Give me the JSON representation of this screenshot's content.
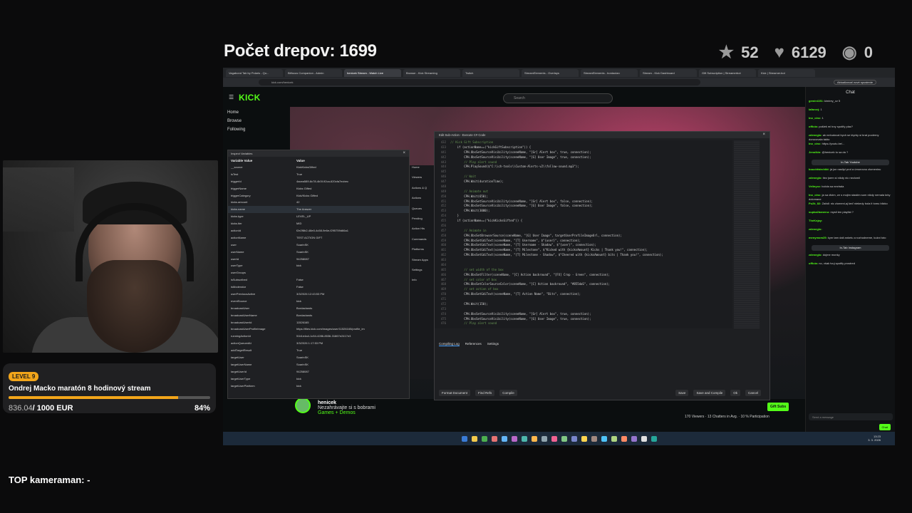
{
  "overlay": {
    "title": "Počet drepov: 1699",
    "stats": [
      {
        "icon": "star-icon",
        "glyph": "★",
        "value": "52"
      },
      {
        "icon": "heart-icon",
        "glyph": "♥",
        "value": "6129"
      },
      {
        "icon": "eye-icon",
        "glyph": "◉",
        "value": "0"
      }
    ],
    "goal": {
      "level": "LEVEL 9",
      "title": "Ondrej Macko maratón 8 hodinový stream",
      "current": "836.04",
      "total": "/ 1000 EUR",
      "percent_label": "84%",
      "progress": 0.84
    },
    "kameraman": "TOP kameraman: -"
  },
  "browser": {
    "tabs": [
      "Vagabond Tab by Polaris - Qu...",
      "Bitfocus Companion - Admin",
      "henicek Stream - Watch Live",
      "Browse - Kick Streaming",
      "Twitch",
      "StreamElements - Overlays",
      "StreamElements - bordaclan",
      "Stream - Kick Dashboard",
      "Gift Subscription | Streamerbot",
      "Kick | Streamer.bot"
    ],
    "active_tab": 2,
    "url": "kick.com/henicek",
    "update_label": "Aktualizovať nové spustenie"
  },
  "kick": {
    "logo": "KICK",
    "search_placeholder": "Search",
    "nav": [
      "Home",
      "Browse",
      "Following"
    ],
    "streamer_name": "henicek",
    "stream_title": "Nezahrávajte si s bobrami",
    "category": "Games + Demos",
    "tags": [
      "Slovak",
      "czech",
      "polski",
      "slovak"
    ],
    "viewers": "170 Viewers  ·  13 Chatters in Avg.  ·  10 % Participation",
    "gift_label": "Gift Subs",
    "banner_small": "Kill The Vibe"
  },
  "chat": {
    "title": "Chat",
    "messages": [
      {
        "user": "gemini151",
        "text": "kimirey_cz  5"
      },
      {
        "user": "lafarcej",
        "text": "1"
      },
      {
        "user": "Ino_cinc",
        "text": "1"
      },
      {
        "user": "officia",
        "text": "pošleš mi trvy spotify plaz?"
      },
      {
        "user": "zdenegio",
        "text": "ak nečudoval bych se ktyrby si brat poolerny dorucovala takto"
      },
      {
        "user": "Ino_cinc",
        "text": "https://youtu.be/..."
      },
      {
        "user": "Jenolkin",
        "text": "@henicek to sa da ?"
      },
      {
        "user": "bouchfairchild",
        "text": "já jsn naslipl prot a úmorovou zlomeninu"
      },
      {
        "user": "zdenegio",
        "text": "tiez jsem si nikdy nic nezlomil"
      },
      {
        "user": "Velinycz",
        "text": "bolvla sa neztrala"
      },
      {
        "user": "Ino_cinc",
        "text": "ja sa divim, ze s mojim stastim som nikdy nemala krky dolomane"
      },
      {
        "user": "Pu2k_82",
        "text": "Zafall: nic zlomeni,aj keď niekedy bola it tomu blizko"
      },
      {
        "user": "supka2banenu",
        "text": "mysli ten playlist ?"
      },
      {
        "user": "TheKnjay",
        "text": ""
      },
      {
        "user": "zdenegio",
        "text": ""
      },
      {
        "user": "menymom25",
        "text": "kym tam dali anketu a rozhodneme, kukni toto"
      },
      {
        "user": "zdenegio",
        "text": "dojme monky"
      },
      {
        "user": "officia",
        "text": "no, však tvuj spotify prostred"
      }
    ],
    "pills": [
      "In-Tab Youtube",
      "In-Tab Instagram"
    ],
    "send_placeholder": "Send a message",
    "points": "2,410",
    "chat_button": "Chat"
  },
  "inspect": {
    "title": "Inspect Variables",
    "col1": "Variable Value",
    "col2": "Value",
    "rows": [
      [
        "__source",
        "KickKicksGifted"
      ],
      [
        "isTest",
        "True"
      ],
      [
        "triggerId",
        "4acea589-8c78-4b3f-92ca-620cfa7ecbec"
      ],
      [
        "triggerName",
        "Kicks Gifted"
      ],
      [
        "triggerCategory",
        "Kick/Kicks Gifted"
      ],
      [
        "kicks.amount",
        "42"
      ],
      [
        "kicks.name",
        "The Answer"
      ],
      [
        "kicks.type",
        "LEVEL_UP"
      ],
      [
        "kicks.tier",
        "MID"
      ],
      [
        "actionId",
        "f2e2f8b2-48e0-4c58-9e6e-f295759d66a1"
      ],
      [
        "actionName",
        "TEST ACTION GIFT"
      ],
      [
        "user",
        "SoarinSK"
      ],
      [
        "userName",
        "SoarinSK"
      ],
      [
        "userId",
        "94258087"
      ],
      [
        "userType",
        "kick"
      ],
      [
        "userGroups",
        ""
      ],
      [
        "isSubscribed",
        "False"
      ],
      [
        "isModerator",
        "False"
      ],
      [
        "userPreviousActive",
        "3/3/2026 12:43:53 PM"
      ],
      [
        "eventSource",
        "kick"
      ],
      [
        "broadcastUser",
        "Bordaclands"
      ],
      [
        "broadcastUserName",
        "Bordaclands"
      ],
      [
        "broadcastUserId",
        "11526165"
      ],
      [
        "broadcastUserProfileImage",
        "https://files.kick.com/images/user/11526165/profile_im"
      ],
      [
        "runningActionId",
        "51b1e4a4-1c54-4286-8536-31867e2417e3"
      ],
      [
        "actionQueuedAt",
        "3/3/2026 1:17:53 PM"
      ],
      [
        "addTargetResult",
        "True"
      ],
      [
        "targetUser",
        "SoarinSK"
      ],
      [
        "targetUserName",
        "SoarinSK"
      ],
      [
        "targetUserId",
        "94258087"
      ],
      [
        "targetUserType",
        "kick"
      ],
      [
        "targetUserPlatform",
        "kick"
      ]
    ]
  },
  "midnav": [
    "Home",
    "Viewers",
    "Actions & Q",
    "Actions",
    "Queues",
    "Pending",
    "Action His",
    "Commands",
    "Platforms",
    "Stream Apps",
    "Settings",
    "Info"
  ],
  "editor": {
    "title": "Edit Sub-Action - Execute C# Code",
    "lines": [
      [
        "432",
        "// Kick Gift Subscription"
      ],
      [
        "433",
        "    if (actionName==(\"kickGiftSubscription\")) {"
      ],
      [
        "441",
        "        CPH.ObsSetSourceVisibility(sceneName, \"[Gr] Alert box\", true, connection);"
      ],
      [
        "442",
        "        CPH.ObsSetSourceVisibility(sceneName, \"[G] User Image\", true, connection);"
      ],
      [
        "443",
        "        // Play alert sound"
      ],
      [
        "444",
        "        CPH.PlaySound($\"C:\\\\ch-tools\\\\Custom-Alerts-v2\\\\follow-sound.mp3\");"
      ],
      [
        "445",
        ""
      ],
      [
        "446",
        "        // Wait"
      ],
      [
        "447",
        "        CPH.Wait(durationTime);"
      ],
      [
        "448",
        ""
      ],
      [
        "449",
        "        // Animate out"
      ],
      [
        "450",
        "        CPH.Wait(650);"
      ],
      [
        "451",
        "        CPH.ObsSetSourceVisibility(sceneName, \"[Gr] Alert box\", false, connection);"
      ],
      [
        "452",
        "        CPH.ObsSetSourceVisibility(sceneName, \"[G] User Image\", false, connection);"
      ],
      [
        "453",
        "        CPH.Wait(3000);"
      ],
      [
        "454",
        "    }"
      ],
      [
        "455",
        "    if (actionName==(\"kickKicksGifted\")) {"
      ],
      [
        "456",
        ""
      ],
      [
        "457",
        "        // Animate in"
      ],
      [
        "458",
        "        CPH.ObsSetBrowserSource(sceneName, \"[G] User Image\", targetUserProfileImageUrl, connection);"
      ],
      [
        "459",
        "        CPH.ObsSetGdiText(sceneName, \"[T] Username\", $\"{user}\", connection);"
      ],
      [
        "460",
        "        CPH.ObsSetGdiText(sceneName, \"[T] Username - Shadow\", $\"{user}\", connection);"
      ],
      [
        "461",
        "        CPH.ObsSetGdiText(sceneName, \"[T] Milestone\", $\"Kicked with {kicksAmount} Kicks | Thank you!\", connection);"
      ],
      [
        "462",
        "        CPH.ObsSetGdiText(sceneName, \"[T] Milestone - Shadow\", $\"Cheered with {kicksAmount} bits | Thank you!\", connection);"
      ],
      [
        "463",
        ""
      ],
      [
        "464",
        ""
      ],
      [
        "465",
        "        // set width of the box"
      ],
      [
        "466",
        "        CPH.ObsSetFilter(sceneName, \"[C] Action backround\", \"[FX] Crop - Green\", connection);"
      ],
      [
        "467",
        "        // set color of box"
      ],
      [
        "468",
        "        CPH.ObsSetColorSourceColor(sceneName, \"[C] Action backround\", \"#855daS\", connection);"
      ],
      [
        "469",
        "        // set action of box"
      ],
      [
        "470",
        "        CPH.ObsSetGdiText(sceneName, \"[T] Action Name\", \"Bits\", connection);"
      ],
      [
        "471",
        ""
      ],
      [
        "472",
        "        CPH.Wait(150);"
      ],
      [
        "473",
        ""
      ],
      [
        "474",
        "        CPH.ObsSetSourceVisibility(sceneName, \"[Gr] Alert box\", true, connection);"
      ],
      [
        "475",
        "        CPH.ObsSetSourceVisibility(sceneName, \"[G] User Image\", true, connection);"
      ],
      [
        "476",
        "        // Play alert sound"
      ]
    ],
    "tabs": [
      "Compiling Log",
      "References",
      "Settings"
    ],
    "left_buttons": [
      "Format Document",
      "Find Refs",
      "Compile"
    ],
    "right_buttons": [
      "Save",
      "Save and Compile",
      "Ok",
      "Cancel"
    ]
  },
  "taskbar": {
    "time": "13:23",
    "date": "3. 3. 2026"
  }
}
